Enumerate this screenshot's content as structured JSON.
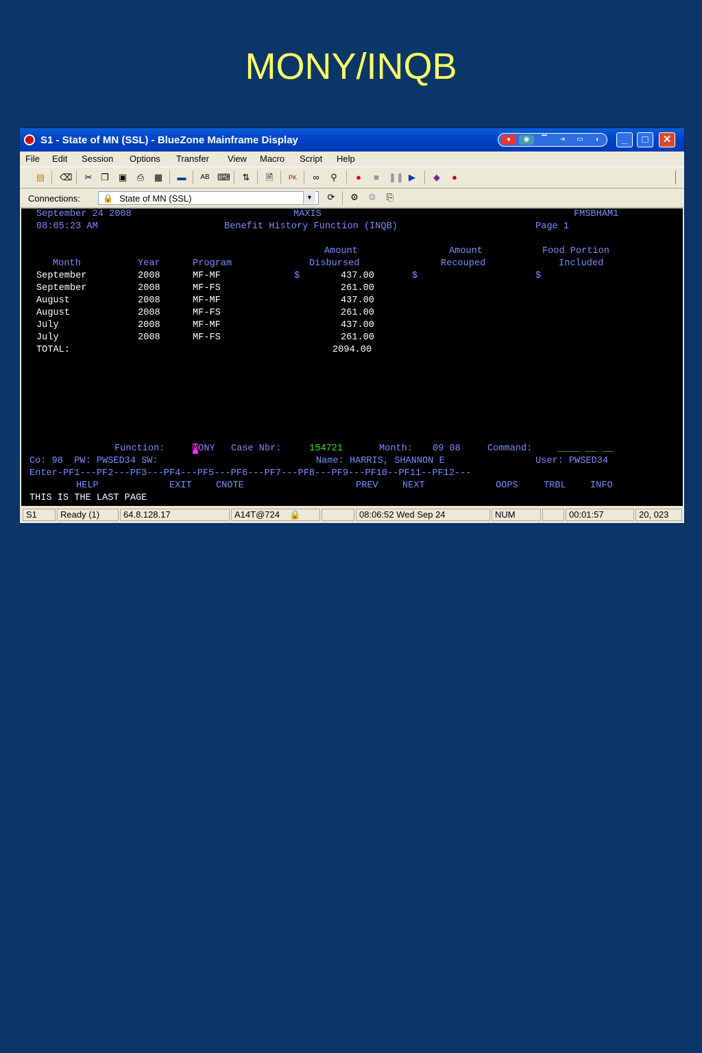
{
  "slide": {
    "title": "MONY/INQB"
  },
  "window": {
    "title": "S1 - State of MN (SSL) - BlueZone Mainframe Display",
    "menu": [
      "File",
      "Edit",
      "Session",
      "Options",
      "Transfer",
      "View",
      "Macro",
      "Script",
      "Help"
    ],
    "connections_label": "Connections:",
    "connection_value": "State of MN (SSL)"
  },
  "screen": {
    "date": "September 24 2008",
    "system": "MAXIS",
    "screen_id": "FMSBHAM1",
    "time": "08:05:23 AM",
    "heading": "Benefit History Function (INQB)",
    "page": "Page 1",
    "col_amount_1": "Amount",
    "col_amount_2": "Amount",
    "col_food_1": "Food Portion",
    "headers": {
      "month": "Month",
      "year": "Year",
      "program": "Program",
      "disbursed": "Disbursed",
      "recouped": "Recouped",
      "included": "Included"
    },
    "rows": [
      {
        "month": "September",
        "year": "2008",
        "program": "MF-MF",
        "dollar1": "$",
        "disbursed": "437.00",
        "dollar2": "$",
        "dollar3": "$"
      },
      {
        "month": "September",
        "year": "2008",
        "program": "MF-FS",
        "dollar1": "",
        "disbursed": "261.00",
        "dollar2": "",
        "dollar3": ""
      },
      {
        "month": "August",
        "year": "2008",
        "program": "MF-MF",
        "dollar1": "",
        "disbursed": "437.00",
        "dollar2": "",
        "dollar3": ""
      },
      {
        "month": "August",
        "year": "2008",
        "program": "MF-FS",
        "dollar1": "",
        "disbursed": "261.00",
        "dollar2": "",
        "dollar3": ""
      },
      {
        "month": "July",
        "year": "2008",
        "program": "MF-MF",
        "dollar1": "",
        "disbursed": "437.00",
        "dollar2": "",
        "dollar3": ""
      },
      {
        "month": "July",
        "year": "2008",
        "program": "MF-FS",
        "dollar1": "",
        "disbursed": "261.00",
        "dollar2": "",
        "dollar3": ""
      }
    ],
    "total_label": "TOTAL:",
    "total_value": "2094.00",
    "function_label": "Function:",
    "function_cursor": "M",
    "function_rest": "ONY",
    "case_label": "Case Nbr:",
    "case_value": "154721",
    "month_label": "Month:",
    "month_value": "09 08",
    "command_label": "Command:",
    "command_value": "____ __ __",
    "co_line": "Co: 98  PW: PWSED34 SW:",
    "name_line": "Name: HARRIS, SHANNON E",
    "user_line": "User: PWSED34",
    "pf_line": "Enter-PF1---PF2---PF3---PF4---PF5---PF6---PF7---PF8---PF9---PF10--PF11--PF12---",
    "pf_help": "HELP",
    "pf_exit": "EXIT",
    "pf_cnote": "CNOTE",
    "pf_prev": "PREV",
    "pf_next": "NEXT",
    "pf_oops": "OOPS",
    "pf_trbl": "TRBL",
    "pf_info": "INFO",
    "message": "THIS IS THE LAST PAGE"
  },
  "status": {
    "session": "S1",
    "state": "Ready (1)",
    "ip": "64.8.128.17",
    "terminal": "A14T@724",
    "datetime": "08:06:52 Wed Sep 24",
    "num": "NUM",
    "elapsed": "00:01:57",
    "cursor": "20, 023"
  },
  "colors": {
    "slide_bg": "#0a3768",
    "title": "#ffff66",
    "terminal_text": "#7a8cff",
    "terminal_value": "#ffffff",
    "terminal_input": "#33dd33"
  }
}
